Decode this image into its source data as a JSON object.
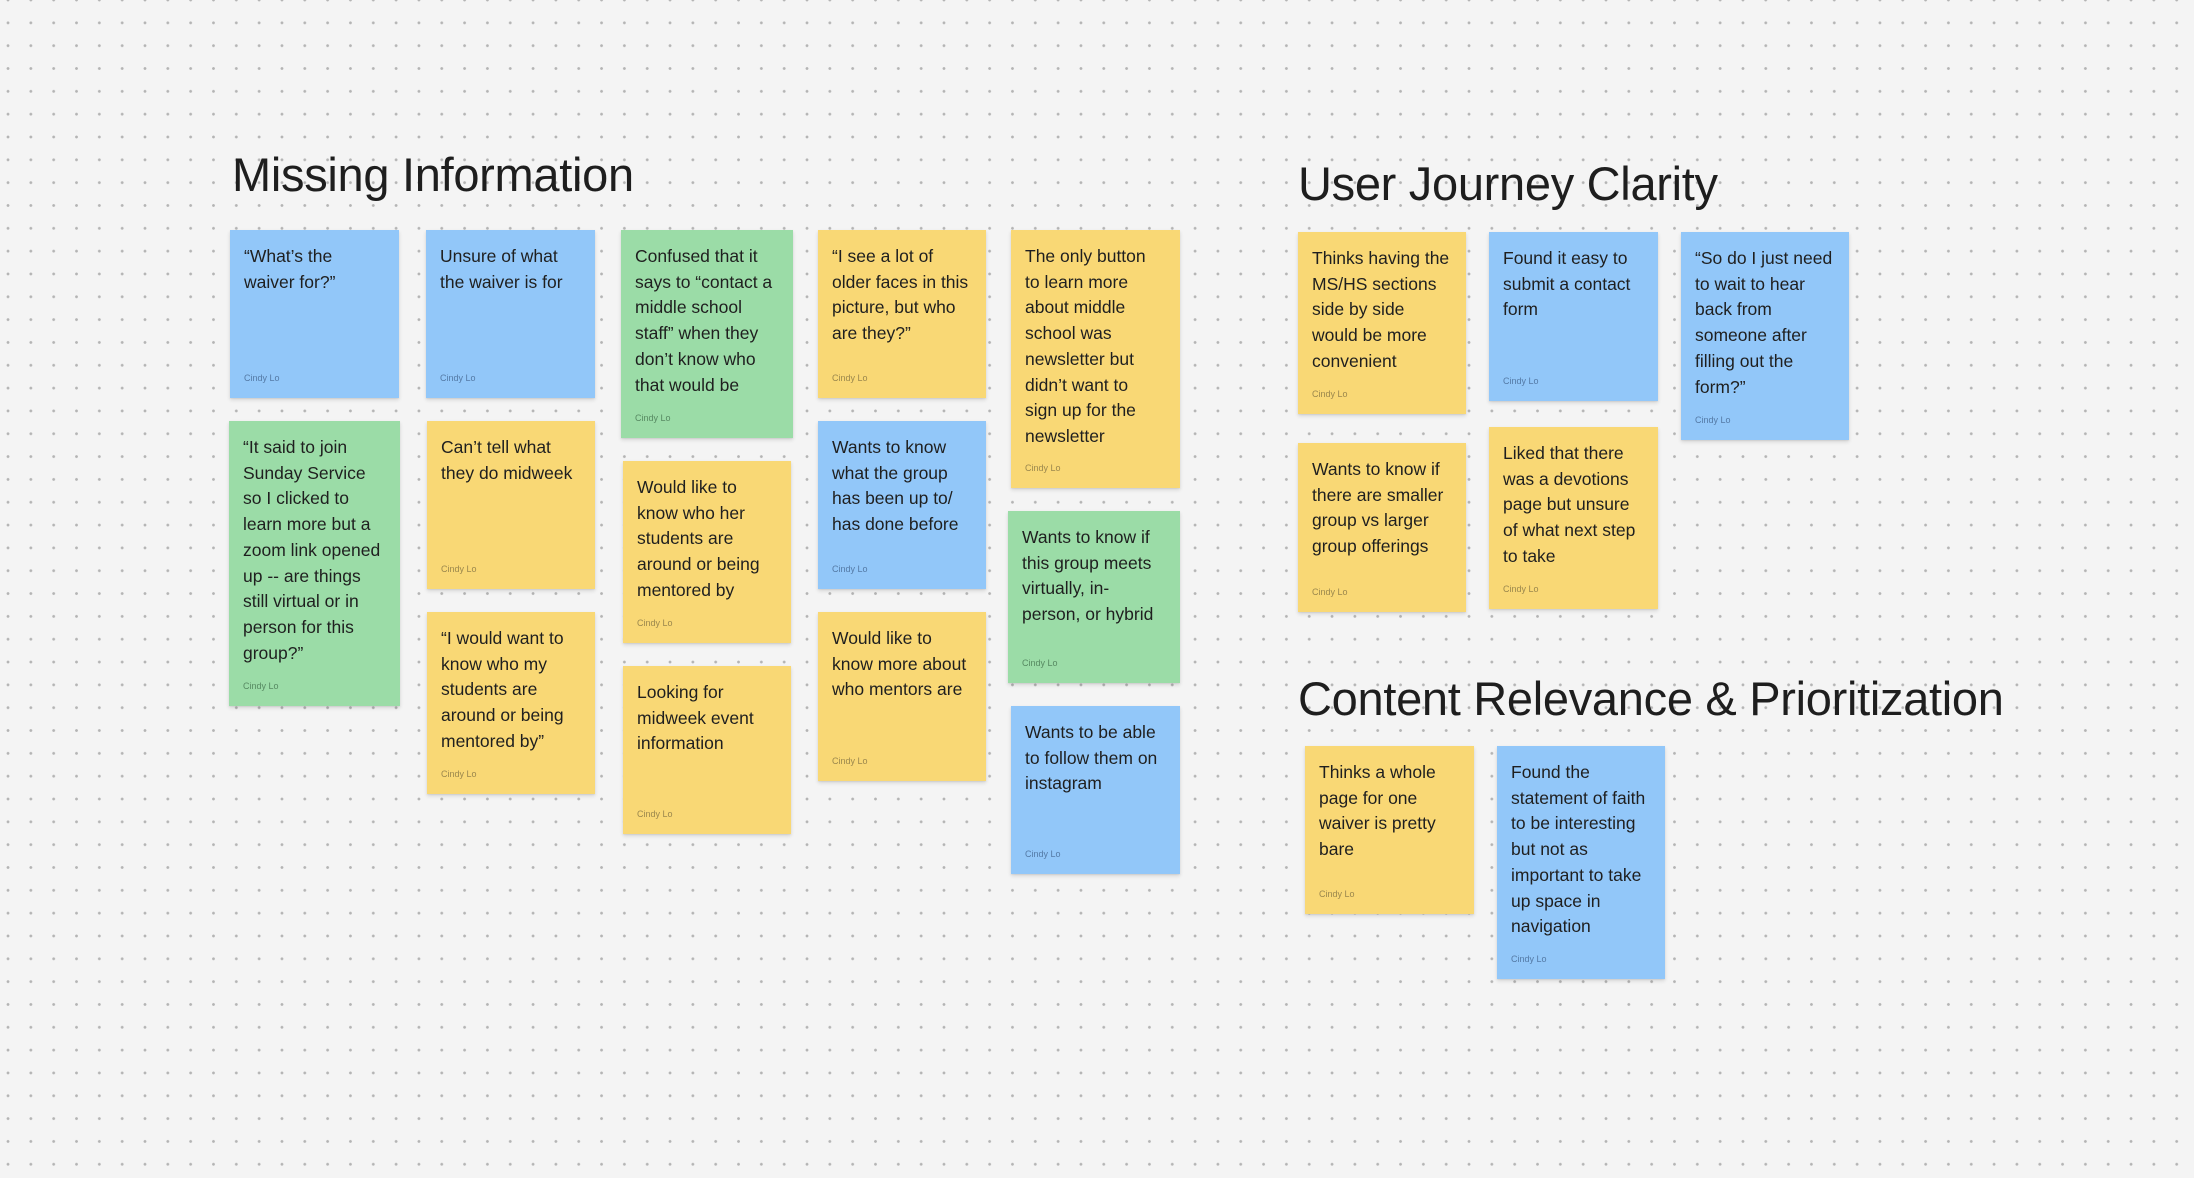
{
  "board": {
    "colors": {
      "background": "#f4f4f4",
      "sticky_yellow": "#f9d875",
      "sticky_blue": "#92c7f9",
      "sticky_green": "#9bdca7",
      "text": "#1e1e1e"
    }
  },
  "sections": [
    {
      "title": "Missing Information",
      "notes": [
        {
          "color": "blue",
          "text": "“What’s the\nwaiver for?”",
          "author": "Cindy Lo"
        },
        {
          "color": "blue",
          "text": "Unsure of what\nthe waiver is for",
          "author": "Cindy Lo"
        },
        {
          "color": "green",
          "text": "Confused that it\nsays to “contact a\nmiddle school\nstaff” when they\ndon’t know who\nthat would be",
          "author": "Cindy Lo"
        },
        {
          "color": "yellow",
          "text": "“I see a lot of\nolder faces in this\npicture, but who\nare they?”",
          "author": "Cindy Lo"
        },
        {
          "color": "yellow",
          "text": "The only button\nto learn more\nabout middle\nschool was\nnewsletter but\ndidn’t want to\nsign up for the\nnewsletter",
          "author": "Cindy Lo"
        },
        {
          "color": "green",
          "text": "“It said to join\nSunday Service\nso I clicked to\nlearn more but a\nzoom link opened\nup -- are things\nstill virtual or in\nperson for this\ngroup?”",
          "author": "Cindy Lo"
        },
        {
          "color": "yellow",
          "text": "Can’t tell what\nthey do midweek",
          "author": "Cindy Lo"
        },
        {
          "color": "yellow",
          "text": "“I would want to\nknow who my\nstudents are\naround or being\nmentored by”",
          "author": "Cindy Lo"
        },
        {
          "color": "yellow",
          "text": "Would like to\nknow who her\nstudents are\naround or being\nmentored by",
          "author": "Cindy Lo"
        },
        {
          "color": "yellow",
          "text": "Looking for\nmidweek event\ninformation",
          "author": "Cindy Lo"
        },
        {
          "color": "blue",
          "text": "Wants to know\nwhat the group\nhas been up to/\nhas done before",
          "author": "Cindy Lo"
        },
        {
          "color": "yellow",
          "text": "Would like to\nknow more about\nwho mentors are",
          "author": "Cindy Lo"
        },
        {
          "color": "green",
          "text": "Wants to know if\nthis group meets\nvirtually, in-\nperson, or hybrid",
          "author": "Cindy Lo"
        },
        {
          "color": "blue",
          "text": "Wants to be able\nto follow them on\ninstagram",
          "author": "Cindy Lo"
        }
      ]
    },
    {
      "title": "User Journey Clarity",
      "notes": [
        {
          "color": "yellow",
          "text": "Thinks having the\nMS/HS sections\nside by side\nwould be more\nconvenient",
          "author": "Cindy Lo"
        },
        {
          "color": "blue",
          "text": "Found it easy to\nsubmit a contact\nform",
          "author": "Cindy Lo"
        },
        {
          "color": "blue",
          "text": "“So do I just need\nto wait to hear\nback from\nsomeone after\nfilling out the\nform?”",
          "author": "Cindy Lo"
        },
        {
          "color": "yellow",
          "text": "Wants to know if\nthere are smaller\ngroup vs larger\ngroup offerings",
          "author": "Cindy Lo"
        },
        {
          "color": "yellow",
          "text": "Liked that there\nwas a devotions\npage but unsure\nof what next step\nto take",
          "author": "Cindy Lo"
        }
      ]
    },
    {
      "title": "Content Relevance & Prioritization",
      "notes": [
        {
          "color": "yellow",
          "text": "Thinks a whole\npage for one\nwaiver is pretty\nbare",
          "author": "Cindy Lo"
        },
        {
          "color": "blue",
          "text": "Found the\nstatement of faith\nto be interesting\nbut not as\nimportant to take\nup space in\nnavigation",
          "author": "Cindy Lo"
        }
      ]
    }
  ]
}
